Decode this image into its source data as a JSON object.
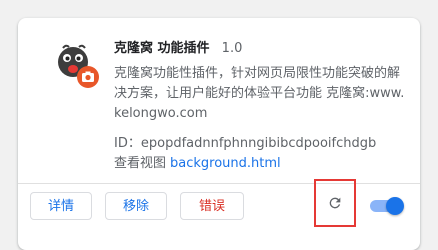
{
  "extension": {
    "name": "克隆窝 功能插件",
    "version": "1.0",
    "description": "克隆窝功能性插件，针对网页局限性功能突破的解决方案，让用户能好的体验平台功能 克隆窝:www.kelongwo.com",
    "id_label": "ID：",
    "id_value": "epopdfadnnfphnngibibcdpooifchdgb",
    "views_label": "查看视图",
    "views_link": "background.html",
    "enabled": true,
    "icon": "bug-mascot-camera-icon"
  },
  "buttons": {
    "details": "详情",
    "remove": "移除",
    "errors": "错误"
  },
  "controls": {
    "reload_icon": "reload-icon",
    "toggle_icon": "toggle-switch"
  },
  "colors": {
    "accent": "#1a73e8",
    "error": "#d93025",
    "highlight_box": "#e53935"
  }
}
